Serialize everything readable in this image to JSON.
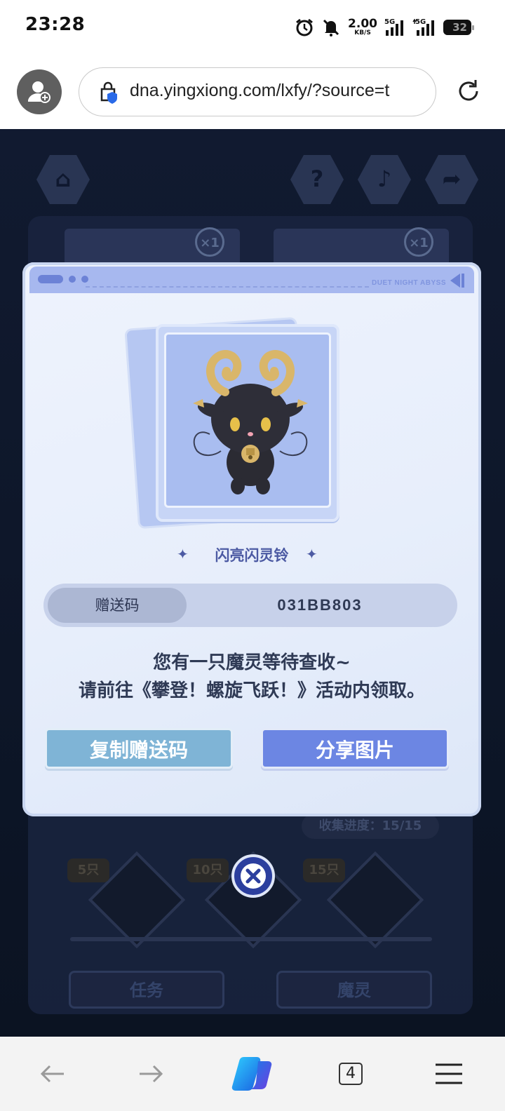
{
  "status_bar": {
    "time": "23:28",
    "net_speed_value": "2.00",
    "net_speed_unit": "KB/S",
    "signal1_label": "5G",
    "signal2_label": "5G",
    "battery_level": "32"
  },
  "browser": {
    "url": "dna.yingxiong.com/lxfy/?source=t",
    "tab_count": "4"
  },
  "dialog": {
    "header_brand": "DUET NIGHT ABYSS",
    "pet_name": "闪亮闪灵铃",
    "code_label": "赠送码",
    "code_value": "031BB803",
    "message_line1": "您有一只魔灵等待查收~",
    "message_line2": "请前往《攀登！螺旋飞跃！》活动内领取。",
    "copy_button": "复制赠送码",
    "share_button": "分享图片"
  },
  "background": {
    "card_multiplier": "×1",
    "progress_text": "收集进度：15/15",
    "milestones": [
      "5只",
      "10只",
      "15只"
    ],
    "tab_task": "任务",
    "tab_spirit": "魔灵"
  },
  "colors": {
    "accent": "#6c86e3",
    "copy_button": "#7fb4d6",
    "dialog_bg": "#e7eefb",
    "game_bg": "#111a30"
  }
}
